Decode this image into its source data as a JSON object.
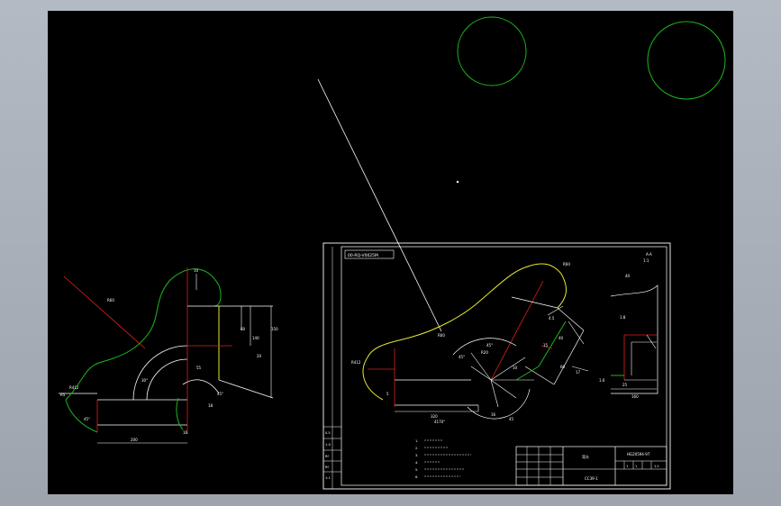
{
  "colors": {
    "background": "#000000",
    "frame": "#a9afb8",
    "white": "#ffffff",
    "green": "#1db81d",
    "yellow": "#e6e635",
    "red": "#e02020"
  },
  "left_view": {
    "dims": {
      "d1": "R60",
      "d2": "R412",
      "d3": "R5",
      "d4": "45°",
      "d5": "45°",
      "d6": "30°",
      "d7": "60",
      "d8": "18",
      "d9": "10",
      "d10": "200",
      "d11": "150",
      "d12": "140",
      "d13": "16",
      "d14": "20",
      "d15": "55"
    }
  },
  "sheet": {
    "label_box": "00-RQ-V0025M",
    "dims": {
      "a1": "R60",
      "a2": "R412",
      "a3": "R60",
      "a4": "45°",
      "a5": "R20",
      "a6": "45°",
      "a7": "5",
      "a8": "16",
      "a9": "45",
      "a10": "10",
      "a11": "4.5",
      "a12": "40",
      "a13": "15",
      "a14": "60",
      "a15": "320",
      "a16": "4170°",
      "a17": "17"
    },
    "section": {
      "title": "A-A",
      "scale": "1:1",
      "dims": {
        "s1": "40",
        "s2": "1:8",
        "s3": "1.6",
        "s4": "160",
        "s5": "25"
      }
    },
    "left_table": {
      "rows": [
        "0.5",
        "1-0",
        "Rf",
        "Rf",
        "1:1"
      ]
    },
    "notes": {
      "n1": "1.",
      "n2": "2.",
      "n3": "3.",
      "n4": "4.",
      "n5": "5.",
      "n6": "6."
    },
    "title_block": {
      "code": "HG20594-97",
      "drawing_no": "CC39-1",
      "name": "弯头",
      "scale": "1:1",
      "sheet": "1",
      "total": "1"
    }
  }
}
